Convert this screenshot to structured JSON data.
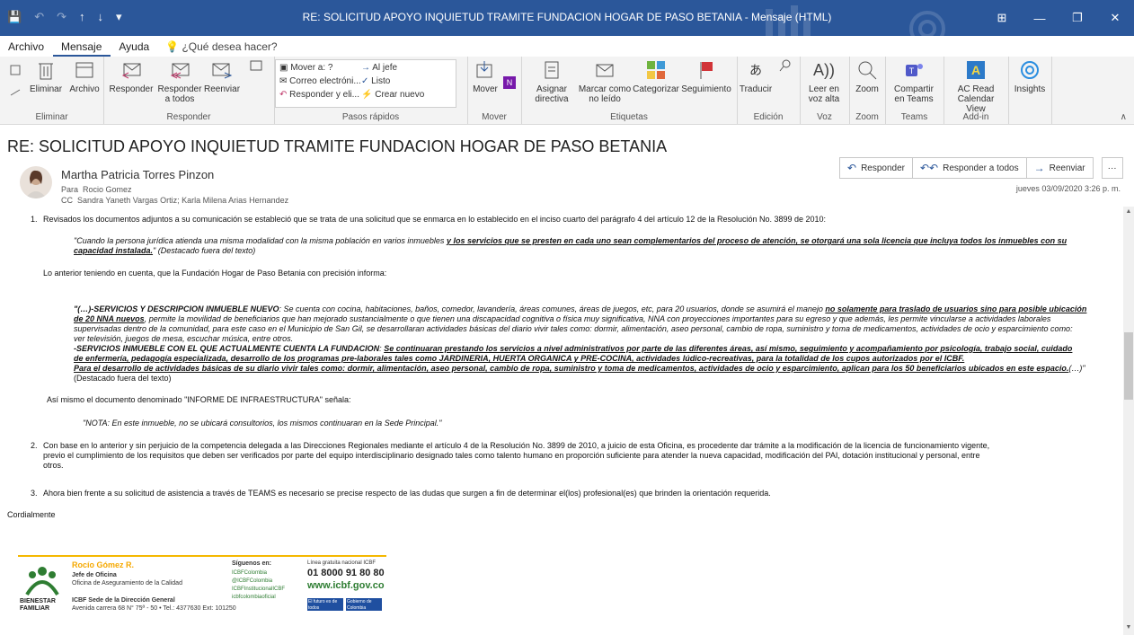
{
  "window": {
    "title": "RE: SOLICITUD APOYO INQUIETUD TRAMITE FUNDACION HOGAR DE PASO BETANIA  -  Mensaje (HTML)",
    "controls": [
      "⊞",
      "—",
      "❐",
      "✕"
    ]
  },
  "quick_access": [
    "💾",
    "↶",
    "↷",
    "↑",
    "↓",
    "▾"
  ],
  "tabs": [
    "Archivo",
    "Mensaje",
    "Ayuda"
  ],
  "tell_me": "¿Qué desea hacer?",
  "ribbon": {
    "eliminar": {
      "label": "Eliminar",
      "buttons": [
        "Eliminar",
        "Archivo"
      ]
    },
    "responder": {
      "label": "Responder",
      "buttons": [
        "Responder",
        "Responder a todos",
        "Reenviar"
      ]
    },
    "pasos_rapidos": {
      "label": "Pasos rápidos",
      "items": [
        "Mover a: ?",
        "Correo electróni...",
        "Responder y eli...",
        "Al jefe",
        "Listo",
        "Crear nuevo"
      ]
    },
    "mover": {
      "label": "Mover",
      "buttons": [
        "Mover"
      ]
    },
    "etiquetas": {
      "label": "Etiquetas",
      "buttons": [
        "Asignar directiva",
        "Marcar como no leído",
        "Categorizar",
        "Seguimiento"
      ]
    },
    "edicion": {
      "label": "Edición",
      "buttons": [
        "Traducir"
      ]
    },
    "voz": {
      "label": "Voz",
      "buttons": [
        "Leer en voz alta"
      ]
    },
    "zoom": {
      "label": "Zoom",
      "buttons": [
        "Zoom"
      ]
    },
    "teams": {
      "label": "Teams",
      "buttons": [
        "Compartir en Teams"
      ]
    },
    "addin": {
      "label": "Add-in",
      "buttons": [
        "AC Read Calendar View"
      ]
    },
    "insights": {
      "buttons": [
        "Insights"
      ]
    }
  },
  "email": {
    "subject": "RE: SOLICITUD APOYO INQUIETUD TRAMITE FUNDACION HOGAR DE PASO BETANIA",
    "sender": "Martha Patricia Torres Pinzon",
    "to_label": "Para",
    "to": "Rocio Gomez",
    "cc_label": "CC",
    "cc": "Sandra Yaneth Vargas Ortiz; Karla Milena Arias Hernandez",
    "date": "jueves 03/09/2020 3:26 p. m.",
    "actions": [
      "Responder",
      "Responder a todos",
      "Reenviar",
      "···"
    ]
  },
  "body": {
    "p1_num": "1.",
    "p1": "Revisados los documentos adjuntos a su comunicación se estableció que se trata de una solicitud que se enmarca en lo establecido en el inciso cuarto del parágrafo 4 del artículo 12 de la Resolución No. 3899 de 2010:",
    "q1_a": "\"Cuando la persona jurídica atienda una misma modalidad con la misma población en varios inmuebles ",
    "q1_b": "y los servicios que se presten en cada uno sean complementarios del proceso de atención, se otorgará una sola licencia que incluya todos los inmuebles con su",
    "q1_c": "capacidad instalada.",
    "q1_d": "\" (Destacado fuera del texto)",
    "p2": "Lo anterior teniendo en cuenta, que la Fundación Hogar de Paso Betania con precisión informa:",
    "q2_l1a": "\"(…)-SERVICIOS Y DESCRIPCION INMUEBLE NUEVO",
    "q2_l1b": ": Se cuenta con cocina, habitaciones, baños, comedor, lavandería, áreas comunes, áreas de juegos, etc, para 20 usuarios, donde se asumirá el manejo ",
    "q2_l1c": "no solamente para traslado de usuarios sino para posible ubicación",
    "q2_l2a": "de 20 NNA nuevos",
    "q2_l2b": ", permite la movilidad de beneficiarios que han mejorado sustancialmente o que tienen una discapacidad cognitiva o física muy significativa, NNA con proyecciones importantes para su egreso y que además, les permite vincularse a actividades laborales",
    "q2_l3": "supervisadas dentro de la comunidad, para este caso en el Municipio de San Gil, se desarrollaran actividades básicas del diario vivir tales como: dormir, alimentación, aseo personal, cambio de ropa, suministro y toma de medicamentos, actividades de ocio y esparcimiento como:",
    "q2_l4": "ver televisión, juegos de mesa, escuchar música, entre otros.",
    "q2_l5a": "-SERVICIOS INMUEBLE CON EL QUE ACTUALMENTE CUENTA LA FUNDACION",
    "q2_l5b": ": ",
    "q2_l5c": "Se continuaran prestando los servicios a nivel administrativos por parte de las diferentes áreas, así mismo, seguimiento y acompañamiento por psicología, trabajo social, cuidado",
    "q2_l6": "de enfermería, pedagogía especializada, desarrollo de los programas pre-laborales tales como JARDINERIA, HUERTA ORGANICA y PRE-COCINA, actividades lúdico-recreativas, para la totalidad de los cupos autorizados por el ICBF.",
    "q2_l7a": "Para el desarrollo de actividades básicas de su diario vivir tales como: dormir, alimentación, aseo personal, cambio de ropa, suministro y toma de medicamentos, actividades de ocio y esparcimiento, aplican para los 50 beneficiarios ubicados en este espacio.",
    "q2_l7b": "(…)\"",
    "q2_l8": "(Destacado fuera del texto)",
    "p3": "Así mismo el documento denominado \"INFORME DE INFRAESTRUCTURA\" señala:",
    "q3": "\"NOTA: En este inmueble, no se ubicará consultorios, los mismos continuaran en la Sede Principal.\"",
    "p4_num": "2.",
    "p4_l1": "Con base en lo anterior y sin perjuicio de la competencia delegada a las Direcciones Regionales mediante el artículo 4 de la Resolución No. 3899 de 2010, a juicio de esta Oficina, es procedente dar trámite a la modificación de la licencia de funcionamiento vigente,",
    "p4_l2": "previo el cumplimiento de los requisitos que deben ser verificados por parte del equipo interdisciplinario designado tales como talento humano en proporción suficiente para atender la nueva capacidad, modificación del PAI, dotación institucional y personal, entre",
    "p4_l3": "otros.",
    "p5_num": "3.",
    "p5": "Ahora bien frente a su solicitud de asistencia a través de TEAMS es necesario se precise respecto de las dudas que surgen a fin de determinar el(los) profesional(es) que brinden la orientación requerida.",
    "closing": "Cordialmente"
  },
  "signature": {
    "logo_text": "BIENESTAR FAMILIAR",
    "name": "Rocío Gómez R.",
    "role": "Jefe de Oficina",
    "office": "Oficina de Aseguramiento  de la Calidad",
    "address1": "ICBF Sede de la Dirección General",
    "address2": "Avenida carrera  68 N° 75ª - 50 • Tel.: 4377630 Ext: 101250",
    "follow": "Síguenos en:",
    "social": [
      "ICBFColombia",
      "@ICBFColombia",
      "ICBFInstitucionalICBF",
      "icbfcolombiaoficial"
    ],
    "hotline_label": "Línea gratuita nacional ICBF",
    "hotline": "01 8000 91 80 80",
    "web": "www.icbf.gov.co",
    "badge1": "El futuro es de todos",
    "badge2": "Gobierno de Colombia"
  }
}
